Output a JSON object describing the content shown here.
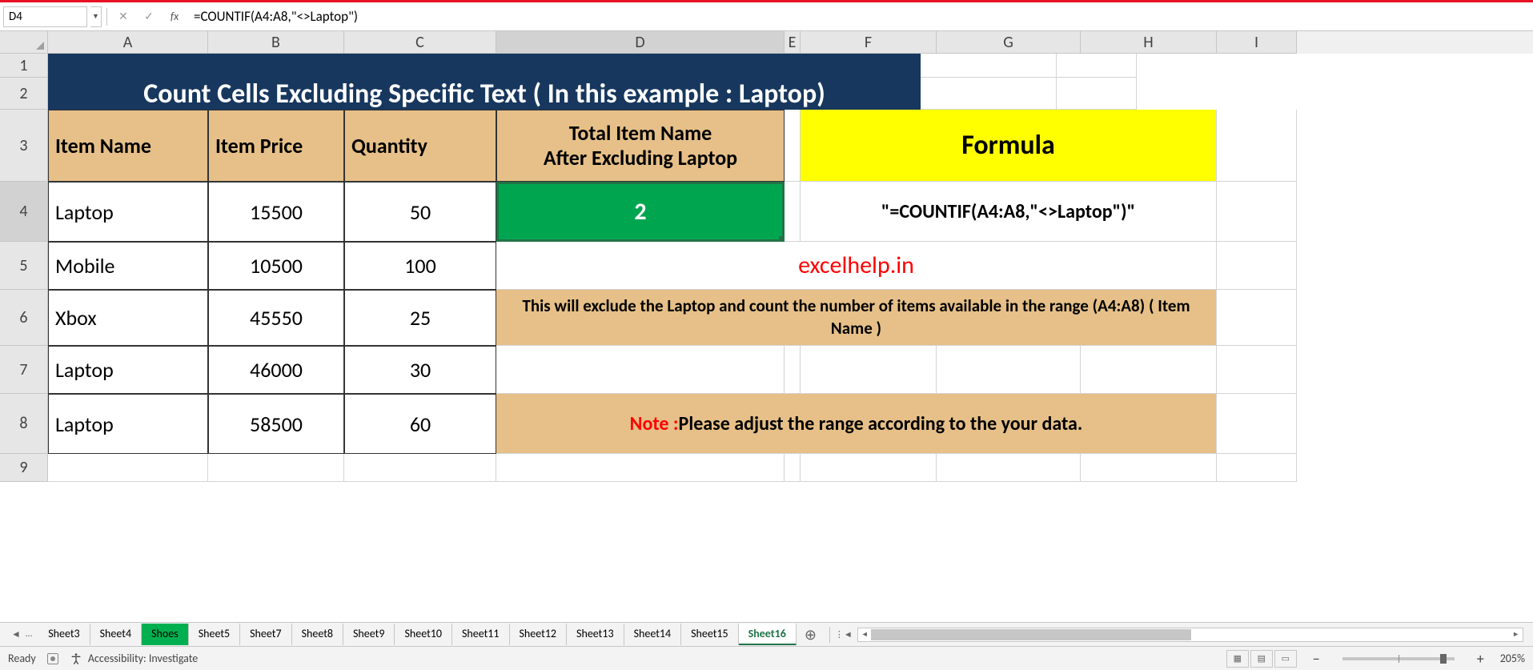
{
  "name_box": "D4",
  "formula_bar": "=COUNTIF(A4:A8,\"<>Laptop\")",
  "columns": [
    "A",
    "B",
    "C",
    "D",
    "E",
    "F",
    "G",
    "H",
    "I"
  ],
  "rows": [
    "1",
    "2",
    "3",
    "4",
    "5",
    "6",
    "7",
    "8",
    "9"
  ],
  "banner": "Count Cells Excluding Specific Text ( In this example : Laptop)",
  "headers": {
    "a": "Item Name",
    "b": "Item Price",
    "c": "Quantity",
    "d1": "Total Item Name",
    "d2": "After Excluding Laptop",
    "f": "Formula"
  },
  "data_rows": [
    {
      "name": "Laptop",
      "price": "15500",
      "qty": "50"
    },
    {
      "name": "Mobile",
      "price": "10500",
      "qty": "100"
    },
    {
      "name": "Xbox",
      "price": "45550",
      "qty": "25"
    },
    {
      "name": "Laptop",
      "price": "46000",
      "qty": "30"
    },
    {
      "name": "Laptop",
      "price": "58500",
      "qty": "60"
    }
  ],
  "result_value": "2",
  "formula_display": "\"=COUNTIF(A4:A8,\"<>Laptop\")\"",
  "watermark": "excelhelp.in",
  "explanation": "This will exclude the Laptop and count the number of items available in the range (A4:A8) ( Item Name )",
  "note_label": "Note : ",
  "note_text": "Please adjust the range according to the your data.",
  "sheet_tabs": [
    "Sheet3",
    "Sheet4",
    "Shoes",
    "Sheet5",
    "Sheet7",
    "Sheet8",
    "Sheet9",
    "Sheet10",
    "Sheet11",
    "Sheet12",
    "Sheet13",
    "Sheet14",
    "Sheet15",
    "Sheet16"
  ],
  "active_tab": "Sheet16",
  "green_tab": "Shoes",
  "status": {
    "ready": "Ready",
    "acc": "Accessibility: Investigate",
    "zoom": "205%"
  },
  "chart_data": {
    "type": "table",
    "title": "Count Cells Excluding Specific Text ( In this example : Laptop)",
    "columns": [
      "Item Name",
      "Item Price",
      "Quantity"
    ],
    "rows": [
      [
        "Laptop",
        15500,
        50
      ],
      [
        "Mobile",
        10500,
        100
      ],
      [
        "Xbox",
        45550,
        25
      ],
      [
        "Laptop",
        46000,
        30
      ],
      [
        "Laptop",
        58500,
        60
      ]
    ],
    "computed": {
      "label": "Total Item Name After Excluding Laptop",
      "value": 2,
      "formula": "=COUNTIF(A4:A8,\"<>Laptop\")"
    }
  }
}
